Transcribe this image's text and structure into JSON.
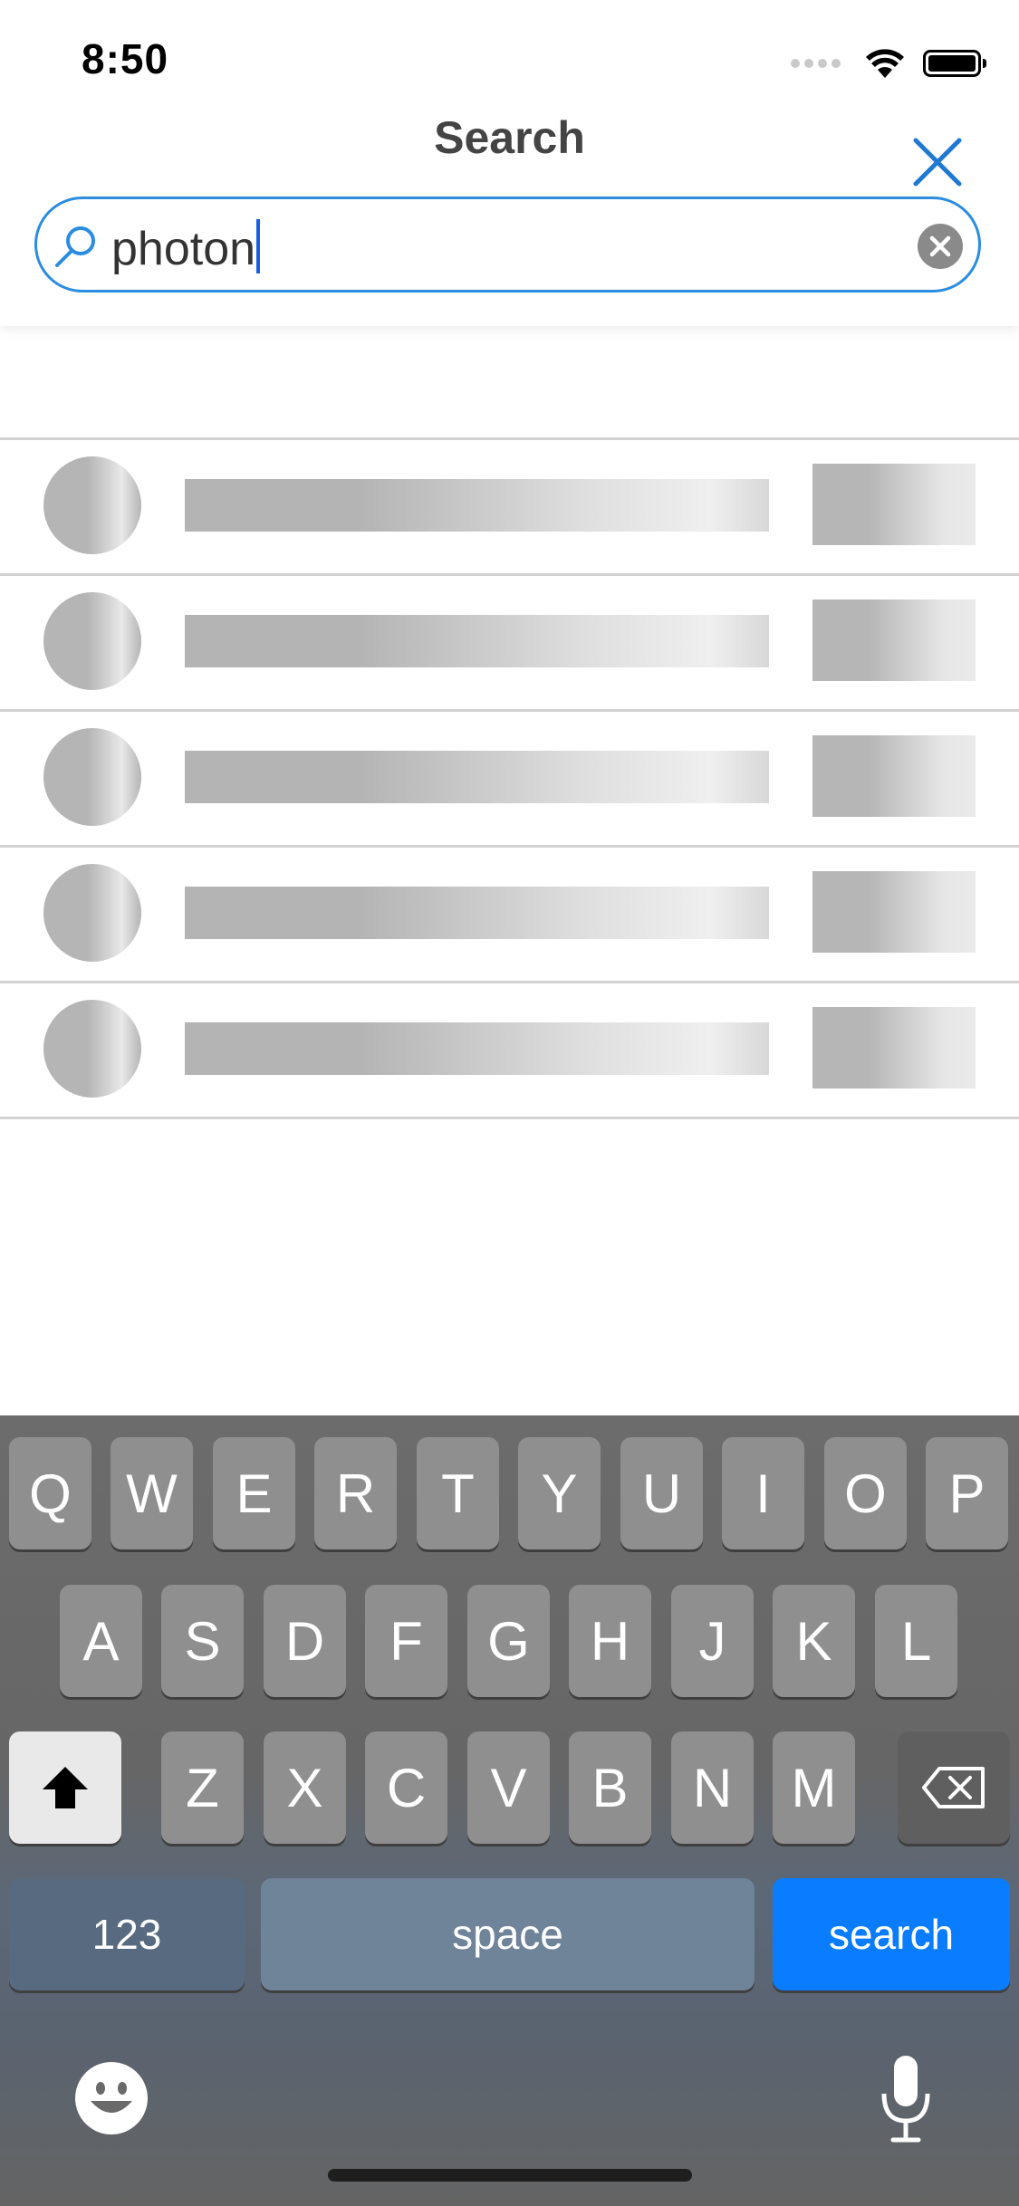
{
  "status_bar": {
    "time": "8:50",
    "icons": [
      "signal-dots-icon",
      "wifi-icon",
      "battery-icon"
    ]
  },
  "header": {
    "title": "Search",
    "close_icon": "close-icon"
  },
  "search": {
    "value": "photon",
    "search_icon": "search-icon",
    "clear_icon": "clear-icon"
  },
  "results": {
    "state": "loading",
    "skeleton_rows": 5
  },
  "keyboard": {
    "row1": [
      "Q",
      "W",
      "E",
      "R",
      "T",
      "Y",
      "U",
      "I",
      "O",
      "P"
    ],
    "row2": [
      "A",
      "S",
      "D",
      "F",
      "G",
      "H",
      "J",
      "K",
      "L"
    ],
    "row3": [
      "Z",
      "X",
      "C",
      "V",
      "B",
      "N",
      "M"
    ],
    "numbers_label": "123",
    "space_label": "space",
    "search_label": "search",
    "shift_icon": "shift-icon",
    "backspace_icon": "backspace-icon",
    "emoji_icon": "emoji-icon",
    "mic_icon": "microphone-icon"
  },
  "colors": {
    "accent": "#2b8de0",
    "search_key": "#0a7cff",
    "skeleton": "#b5b5b5"
  }
}
